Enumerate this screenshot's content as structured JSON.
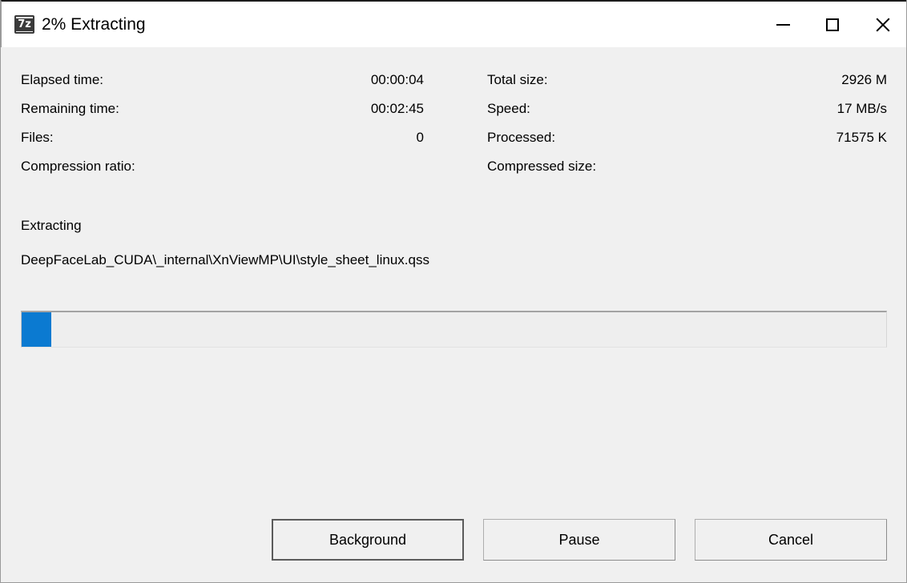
{
  "window": {
    "title": "2% Extracting",
    "app_icon": "7z",
    "icon_name": "sevenzip-icon",
    "controls": {
      "minimize": "minimize-icon",
      "maximize": "maximize-icon",
      "close": "close-icon"
    }
  },
  "stats": {
    "left": [
      {
        "label": "Elapsed time:",
        "value": "00:00:04"
      },
      {
        "label": "Remaining time:",
        "value": "00:02:45"
      },
      {
        "label": "Files:",
        "value": "0"
      },
      {
        "label": "Compression ratio:",
        "value": ""
      }
    ],
    "right": [
      {
        "label": "Total size:",
        "value": "2926 M"
      },
      {
        "label": "Speed:",
        "value": "17 MB/s"
      },
      {
        "label": "Processed:",
        "value": "71575 K"
      },
      {
        "label": "Compressed size:",
        "value": ""
      }
    ]
  },
  "operation": {
    "label": "Extracting",
    "filepath": "DeepFaceLab_CUDA\\_internal\\XnViewMP\\UI\\style_sheet_linux.qss"
  },
  "progress": {
    "percent": "2%",
    "fill_color": "#0b7ad1",
    "track_color": "#eeeeee"
  },
  "buttons": {
    "background": "Background",
    "pause": "Pause",
    "cancel": "Cancel"
  }
}
